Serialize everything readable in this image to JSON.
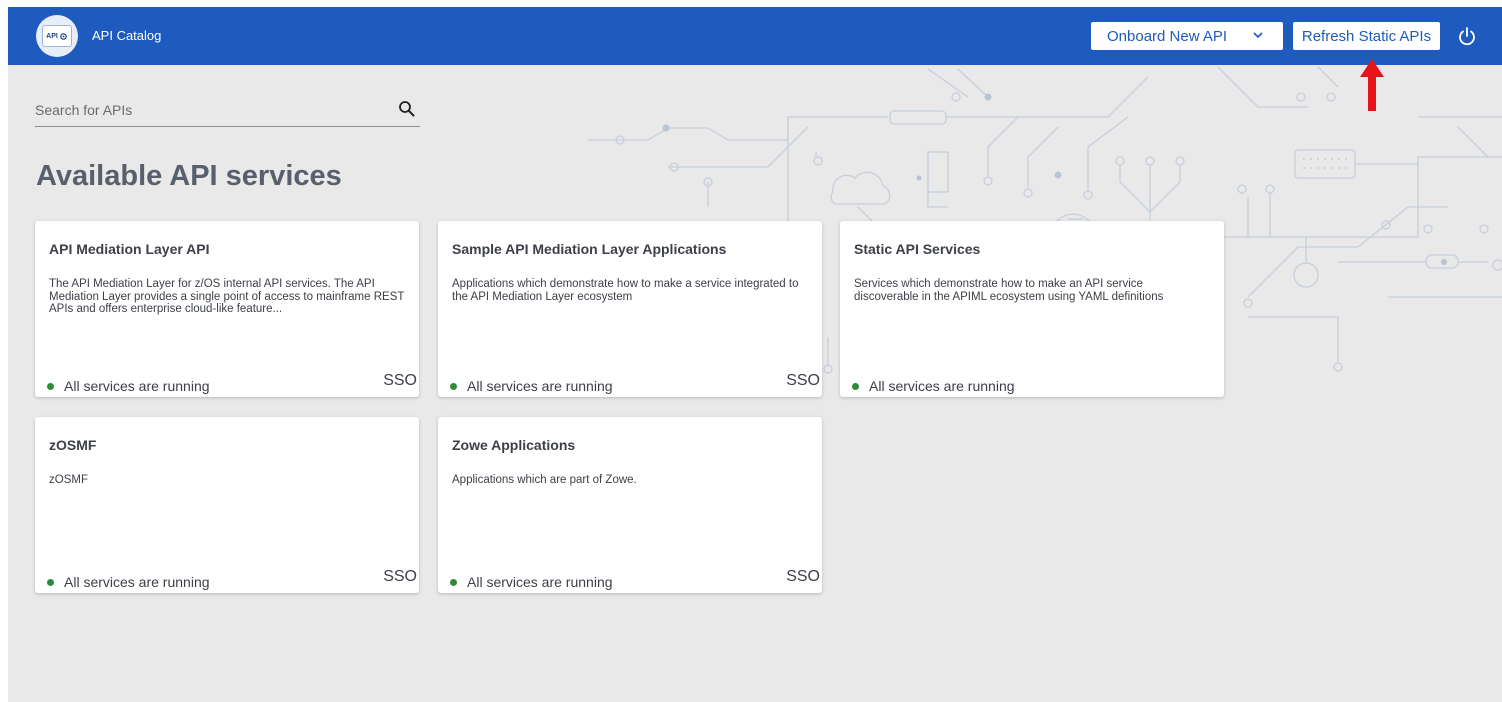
{
  "header": {
    "logo_text": "API",
    "title": "API Catalog",
    "onboard_label": "Onboard New API",
    "refresh_label": "Refresh Static APIs"
  },
  "search": {
    "placeholder": "Search for APIs"
  },
  "page_title": "Available API services",
  "cards": [
    {
      "title": "API Mediation Layer API",
      "description": "The API Mediation Layer for z/OS internal API services. The API Mediation Layer provides a single point of access to mainframe REST APIs and offers enterprise cloud-like feature...",
      "status": "All services are running",
      "sso": "SSO"
    },
    {
      "title": "Sample API Mediation Layer Applications",
      "description": "Applications which demonstrate how to make a service integrated to the API Mediation Layer ecosystem",
      "status": "All services are running",
      "sso": "SSO"
    },
    {
      "title": "Static API Services",
      "description": "Services which demonstrate how to make an API service discoverable in the APIML ecosystem using YAML definitions",
      "status": "All services are running",
      "sso": ""
    },
    {
      "title": "zOSMF",
      "description": "zOSMF",
      "status": "All services are running",
      "sso": "SSO"
    },
    {
      "title": "Zowe Applications",
      "description": "Applications which are part of Zowe.",
      "status": "All services are running",
      "sso": "SSO"
    }
  ],
  "colors": {
    "header_bg": "#1f5bbe",
    "page_bg": "#e9e9e9",
    "status_ok": "#2f8a3c",
    "annotation_arrow": "#e8141c"
  },
  "icons": [
    "api-catalog-logo-icon",
    "chevron-down-icon",
    "power-icon",
    "search-icon",
    "status-dot-icon",
    "red-up-arrow-annotation"
  ]
}
